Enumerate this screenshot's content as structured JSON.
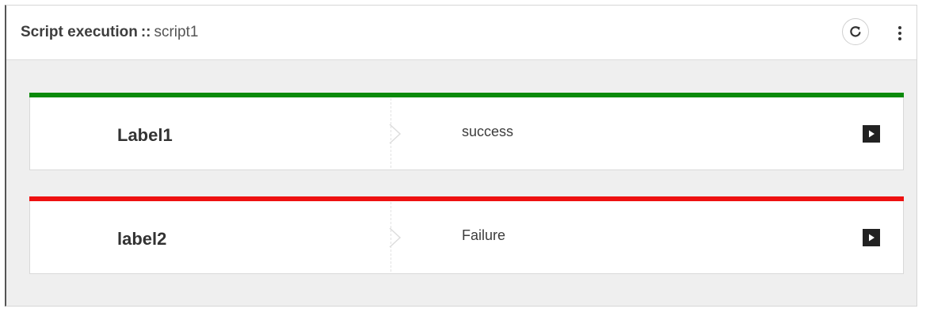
{
  "header": {
    "title": "Script execution",
    "separator": "::",
    "subtitle": "script1",
    "refresh_icon": "refresh-icon",
    "more_icon": "more-vertical-icon"
  },
  "executions": [
    {
      "label": "Label1",
      "status": "success",
      "status_color": "#0b8a0b",
      "action_icon": "play-icon"
    },
    {
      "label": "label2",
      "status": "Failure",
      "status_color": "#ee1111",
      "action_icon": "play-icon"
    }
  ]
}
